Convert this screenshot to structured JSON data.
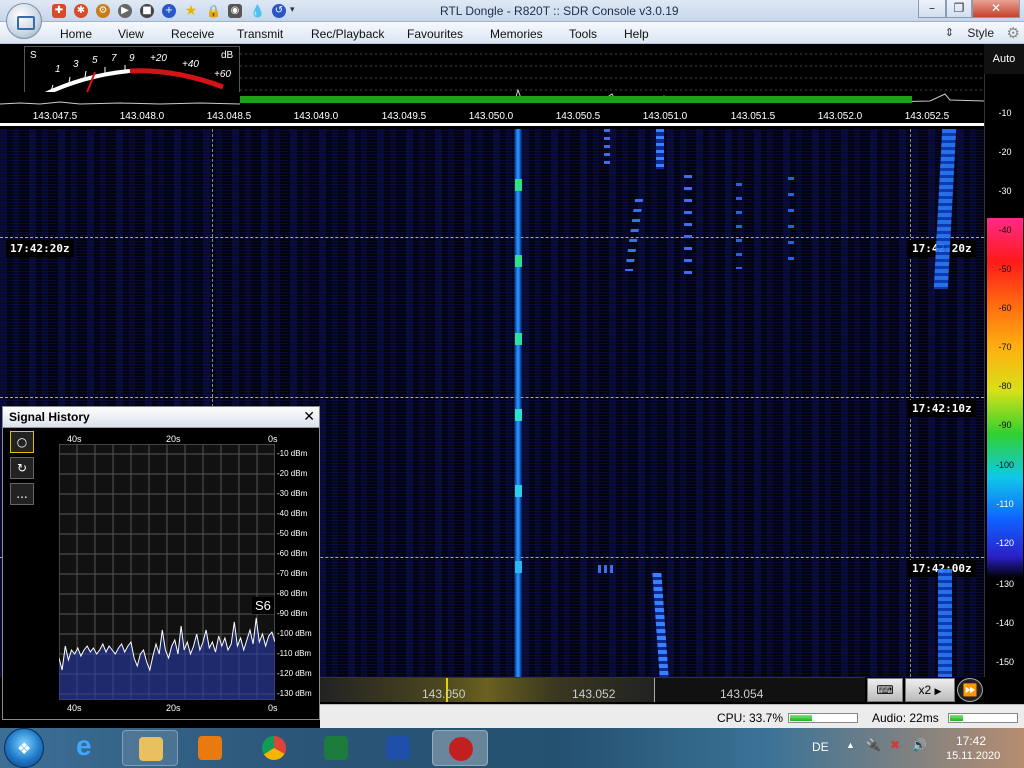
{
  "window": {
    "title": "RTL Dongle - R820T :: SDR Console v3.0.19",
    "controls": {
      "minimize": "–",
      "restore": "❐",
      "close": "✕"
    }
  },
  "quick_access": [
    "lifebuoy-icon",
    "gear-icon",
    "play-icon",
    "stop-icon",
    "plus-icon",
    "star-icon",
    "lock-icon",
    "camera-icon",
    "drop-icon",
    "undo-icon"
  ],
  "menu": {
    "items": [
      "Home",
      "View",
      "Receive",
      "Transmit",
      "Rec/Playback",
      "Favourites",
      "Memories",
      "Tools",
      "Help"
    ],
    "style_label": "Style"
  },
  "s_meter": {
    "s_label": "S",
    "db_label": "dB",
    "s_scale": [
      "1",
      "3",
      "5",
      "7",
      "9"
    ],
    "db_scale": [
      "+20",
      "+40",
      "+60"
    ]
  },
  "spectrum": {
    "auto_label": "Auto",
    "freq_ticks": [
      "143.047.5",
      "143.048.0",
      "143.048.5",
      "143.049.0",
      "143.049.5",
      "143.050.0",
      "143.050.5",
      "143.051.0",
      "143.051.5",
      "143.052.0",
      "143.052.5"
    ]
  },
  "waterfall": {
    "timestamps": [
      "17:42:20z",
      "17:42:10z",
      "17:42:00z"
    ],
    "signals": [
      {
        "freq": "143.050.0",
        "type": "carrier"
      }
    ]
  },
  "db_scale": {
    "gray": [
      "-10",
      "-20",
      "-30"
    ],
    "colored": [
      {
        "label": "-40",
        "color": "#ff2a8a"
      },
      {
        "label": "-50",
        "color": "#ff2020"
      },
      {
        "label": "-60",
        "color": "#ff6a10"
      },
      {
        "label": "-70",
        "color": "#ffb010"
      },
      {
        "label": "-80",
        "color": "#d8e018"
      },
      {
        "label": "-90",
        "color": "#30d030"
      },
      {
        "label": "-100",
        "color": "#10c8e8"
      },
      {
        "label": "-110",
        "color": "#1060ff"
      },
      {
        "label": "-120",
        "color": "#2a20c8"
      }
    ],
    "low": [
      "-130",
      "-140",
      "-150"
    ]
  },
  "bottom": {
    "freqs": [
      "143.050",
      "143.052",
      "143.054"
    ],
    "zoom_label": "x2",
    "cpu_label": "CPU: 33.7%",
    "cpu_fraction": 0.337,
    "audio_label": "Audio: 22ms",
    "audio_fraction": 0.2
  },
  "signal_history": {
    "title": "Signal History",
    "close": "✕",
    "buttons": [
      "○",
      "↻",
      "..."
    ],
    "time_labels": [
      "40s",
      "20s",
      "0s"
    ],
    "dbm_labels": [
      "-10 dBm",
      "-20 dBm",
      "-30 dBm",
      "-40 dBm",
      "-50 dBm",
      "-60 dBm",
      "-70 dBm",
      "-80 dBm",
      "-90 dBm",
      "-100 dBm",
      "-110 dBm",
      "-120 dBm",
      "-130 dBm"
    ],
    "s_reading": "S6",
    "series": [
      -112,
      -118,
      -106,
      -113,
      -108,
      -110,
      -107,
      -111,
      -108,
      -106,
      -109,
      -107,
      -110,
      -108,
      -105,
      -109,
      -106,
      -108,
      -110,
      -107,
      -105,
      -109,
      -106,
      -104,
      -112,
      -116,
      -110,
      -108,
      -114,
      -118,
      -111,
      -105,
      -110,
      -98,
      -108,
      -112,
      -106,
      -103,
      -110,
      -96,
      -108,
      -104,
      -110,
      -106,
      -100,
      -108,
      -104,
      -98,
      -107,
      -104,
      -109,
      -101,
      -106,
      -102,
      -108,
      -105,
      -94,
      -106,
      -102,
      -108,
      -103,
      -98,
      -105,
      -92,
      -104,
      -100,
      -106,
      -101,
      -99,
      -104
    ]
  },
  "taskbar": {
    "apps": [
      "internet-explorer-icon",
      "file-explorer-icon",
      "media-player-icon",
      "chrome-icon",
      "excel-icon",
      "word-icon",
      "sdr-console-icon"
    ],
    "lang": "DE",
    "time": "17:42",
    "date": "15.11.2020"
  }
}
